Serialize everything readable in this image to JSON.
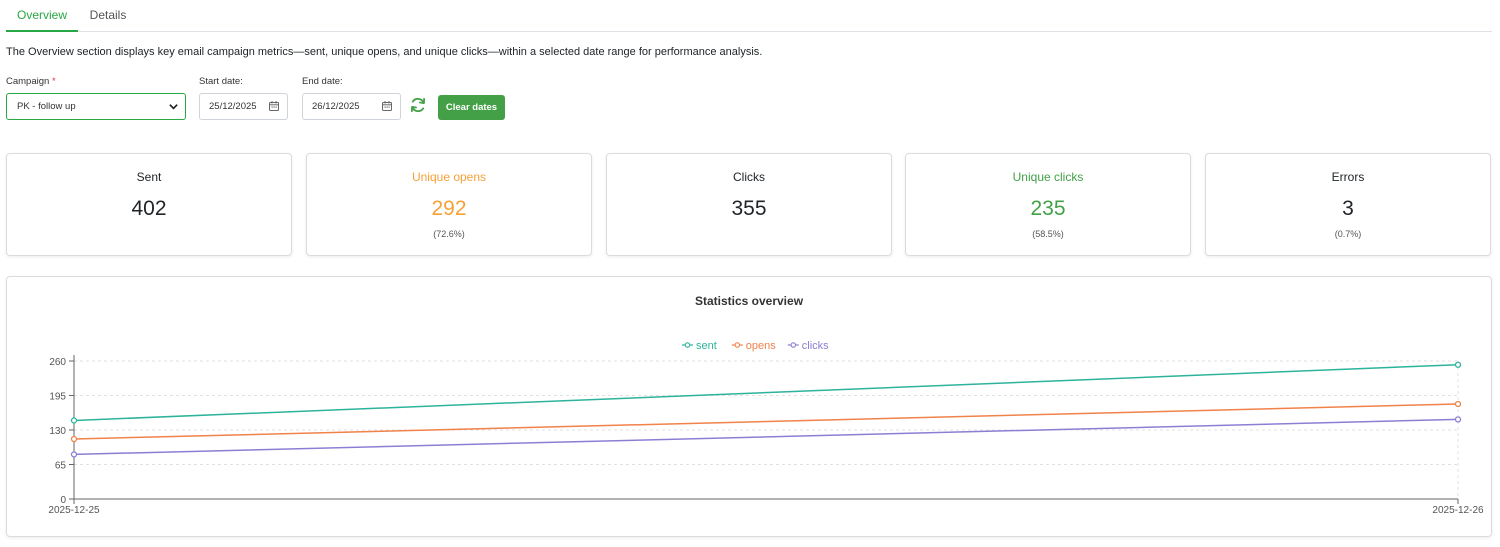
{
  "tabs": [
    {
      "label": "Overview",
      "active": true
    },
    {
      "label": "Details",
      "active": false
    }
  ],
  "description": "The Overview section displays key email campaign metrics—sent, unique opens, and unique clicks—within a selected date range for performance analysis.",
  "filters": {
    "campaign_label": "Campaign",
    "required_mark": "*",
    "campaign_value": "PK - follow up",
    "start_label": "Start date:",
    "start_value": "25/12/2025",
    "end_label": "End date:",
    "end_value": "26/12/2025",
    "clear_label": "Clear dates"
  },
  "metrics": [
    {
      "title": "Sent",
      "value": "402",
      "pct": "",
      "color": "#212529"
    },
    {
      "title": "Unique opens",
      "value": "292",
      "pct": "(72.6%)",
      "color": "#f7a035"
    },
    {
      "title": "Clicks",
      "value": "355",
      "pct": "",
      "color": "#212529"
    },
    {
      "title": "Unique clicks",
      "value": "235",
      "pct": "(58.5%)",
      "color": "#43a047"
    },
    {
      "title": "Errors",
      "value": "3",
      "pct": "(0.7%)",
      "color": "#212529"
    }
  ],
  "colors": {
    "accent": "#28a745",
    "button": "#43a047"
  },
  "chart_data": {
    "type": "line",
    "title": "Statistics overview",
    "x": [
      "2025-12-25",
      "2025-12-26"
    ],
    "series": [
      {
        "name": "sent",
        "values": [
          148,
          253
        ],
        "color": "#2db39b"
      },
      {
        "name": "opens",
        "values": [
          113,
          179
        ],
        "color": "#f0824a"
      },
      {
        "name": "clicks",
        "values": [
          84,
          150
        ],
        "color": "#8b7fd4"
      }
    ],
    "ylim": [
      0,
      260
    ],
    "yticks": [
      0,
      65,
      130,
      195,
      260
    ],
    "grid": true,
    "legend_position": "top-center"
  }
}
